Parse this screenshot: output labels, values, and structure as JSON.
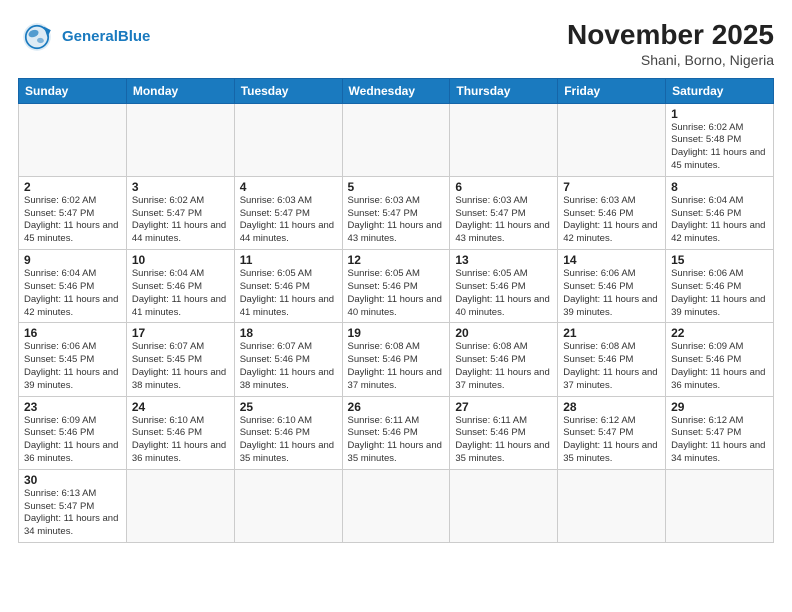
{
  "header": {
    "logo_general": "General",
    "logo_blue": "Blue",
    "month_title": "November 2025",
    "location": "Shani, Borno, Nigeria"
  },
  "weekdays": [
    "Sunday",
    "Monday",
    "Tuesday",
    "Wednesday",
    "Thursday",
    "Friday",
    "Saturday"
  ],
  "weeks": [
    [
      {
        "day": "",
        "info": ""
      },
      {
        "day": "",
        "info": ""
      },
      {
        "day": "",
        "info": ""
      },
      {
        "day": "",
        "info": ""
      },
      {
        "day": "",
        "info": ""
      },
      {
        "day": "",
        "info": ""
      },
      {
        "day": "1",
        "info": "Sunrise: 6:02 AM\nSunset: 5:48 PM\nDaylight: 11 hours and 45 minutes."
      }
    ],
    [
      {
        "day": "2",
        "info": "Sunrise: 6:02 AM\nSunset: 5:47 PM\nDaylight: 11 hours and 45 minutes."
      },
      {
        "day": "3",
        "info": "Sunrise: 6:02 AM\nSunset: 5:47 PM\nDaylight: 11 hours and 44 minutes."
      },
      {
        "day": "4",
        "info": "Sunrise: 6:03 AM\nSunset: 5:47 PM\nDaylight: 11 hours and 44 minutes."
      },
      {
        "day": "5",
        "info": "Sunrise: 6:03 AM\nSunset: 5:47 PM\nDaylight: 11 hours and 43 minutes."
      },
      {
        "day": "6",
        "info": "Sunrise: 6:03 AM\nSunset: 5:47 PM\nDaylight: 11 hours and 43 minutes."
      },
      {
        "day": "7",
        "info": "Sunrise: 6:03 AM\nSunset: 5:46 PM\nDaylight: 11 hours and 42 minutes."
      },
      {
        "day": "8",
        "info": "Sunrise: 6:04 AM\nSunset: 5:46 PM\nDaylight: 11 hours and 42 minutes."
      }
    ],
    [
      {
        "day": "9",
        "info": "Sunrise: 6:04 AM\nSunset: 5:46 PM\nDaylight: 11 hours and 42 minutes."
      },
      {
        "day": "10",
        "info": "Sunrise: 6:04 AM\nSunset: 5:46 PM\nDaylight: 11 hours and 41 minutes."
      },
      {
        "day": "11",
        "info": "Sunrise: 6:05 AM\nSunset: 5:46 PM\nDaylight: 11 hours and 41 minutes."
      },
      {
        "day": "12",
        "info": "Sunrise: 6:05 AM\nSunset: 5:46 PM\nDaylight: 11 hours and 40 minutes."
      },
      {
        "day": "13",
        "info": "Sunrise: 6:05 AM\nSunset: 5:46 PM\nDaylight: 11 hours and 40 minutes."
      },
      {
        "day": "14",
        "info": "Sunrise: 6:06 AM\nSunset: 5:46 PM\nDaylight: 11 hours and 39 minutes."
      },
      {
        "day": "15",
        "info": "Sunrise: 6:06 AM\nSunset: 5:46 PM\nDaylight: 11 hours and 39 minutes."
      }
    ],
    [
      {
        "day": "16",
        "info": "Sunrise: 6:06 AM\nSunset: 5:45 PM\nDaylight: 11 hours and 39 minutes."
      },
      {
        "day": "17",
        "info": "Sunrise: 6:07 AM\nSunset: 5:45 PM\nDaylight: 11 hours and 38 minutes."
      },
      {
        "day": "18",
        "info": "Sunrise: 6:07 AM\nSunset: 5:46 PM\nDaylight: 11 hours and 38 minutes."
      },
      {
        "day": "19",
        "info": "Sunrise: 6:08 AM\nSunset: 5:46 PM\nDaylight: 11 hours and 37 minutes."
      },
      {
        "day": "20",
        "info": "Sunrise: 6:08 AM\nSunset: 5:46 PM\nDaylight: 11 hours and 37 minutes."
      },
      {
        "day": "21",
        "info": "Sunrise: 6:08 AM\nSunset: 5:46 PM\nDaylight: 11 hours and 37 minutes."
      },
      {
        "day": "22",
        "info": "Sunrise: 6:09 AM\nSunset: 5:46 PM\nDaylight: 11 hours and 36 minutes."
      }
    ],
    [
      {
        "day": "23",
        "info": "Sunrise: 6:09 AM\nSunset: 5:46 PM\nDaylight: 11 hours and 36 minutes."
      },
      {
        "day": "24",
        "info": "Sunrise: 6:10 AM\nSunset: 5:46 PM\nDaylight: 11 hours and 36 minutes."
      },
      {
        "day": "25",
        "info": "Sunrise: 6:10 AM\nSunset: 5:46 PM\nDaylight: 11 hours and 35 minutes."
      },
      {
        "day": "26",
        "info": "Sunrise: 6:11 AM\nSunset: 5:46 PM\nDaylight: 11 hours and 35 minutes."
      },
      {
        "day": "27",
        "info": "Sunrise: 6:11 AM\nSunset: 5:46 PM\nDaylight: 11 hours and 35 minutes."
      },
      {
        "day": "28",
        "info": "Sunrise: 6:12 AM\nSunset: 5:47 PM\nDaylight: 11 hours and 35 minutes."
      },
      {
        "day": "29",
        "info": "Sunrise: 6:12 AM\nSunset: 5:47 PM\nDaylight: 11 hours and 34 minutes."
      }
    ],
    [
      {
        "day": "30",
        "info": "Sunrise: 6:13 AM\nSunset: 5:47 PM\nDaylight: 11 hours and 34 minutes."
      },
      {
        "day": "",
        "info": ""
      },
      {
        "day": "",
        "info": ""
      },
      {
        "day": "",
        "info": ""
      },
      {
        "day": "",
        "info": ""
      },
      {
        "day": "",
        "info": ""
      },
      {
        "day": "",
        "info": ""
      }
    ]
  ]
}
